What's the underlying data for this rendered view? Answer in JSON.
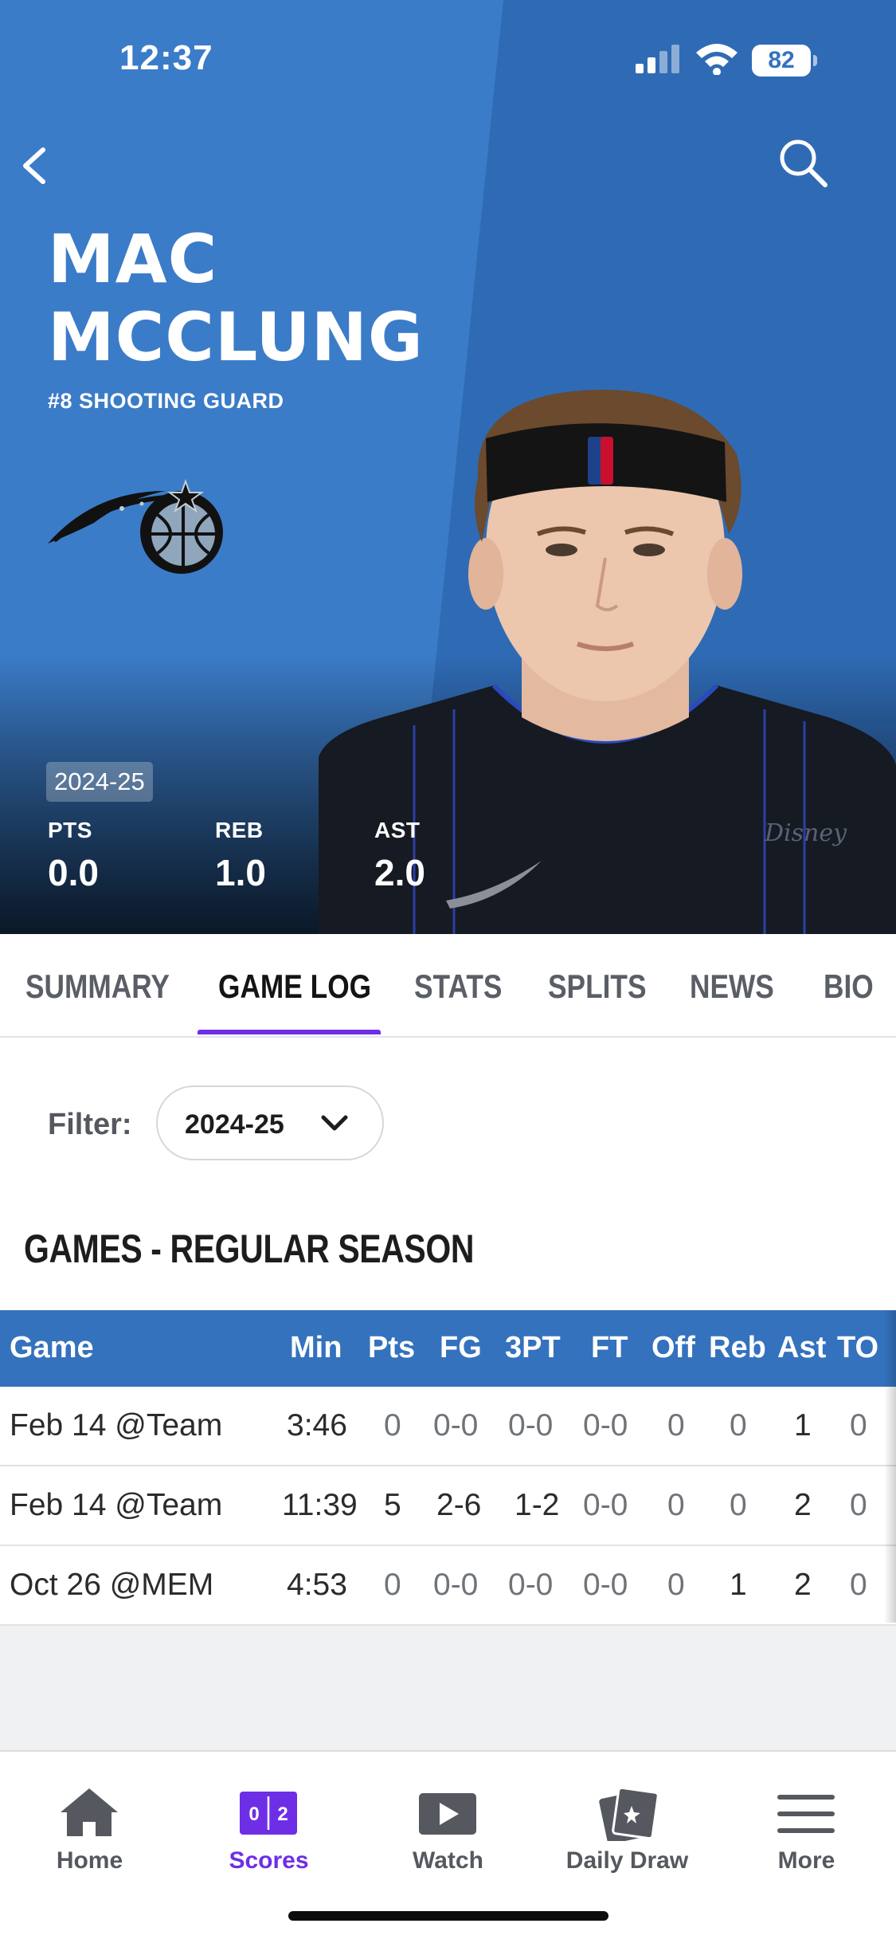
{
  "status": {
    "time": "12:37",
    "battery": "82"
  },
  "player": {
    "first_name": "MAC",
    "last_name": "MCCLUNG",
    "subtitle": "#8 SHOOTING GUARD",
    "season": "2024-25",
    "stats": [
      {
        "label": "PTS",
        "value": "0.0"
      },
      {
        "label": "REB",
        "value": "1.0"
      },
      {
        "label": "AST",
        "value": "2.0"
      }
    ]
  },
  "tabs": [
    "SUMMARY",
    "GAME LOG",
    "STATS",
    "SPLITS",
    "NEWS",
    "BIO"
  ],
  "active_tab": "GAME LOG",
  "filter": {
    "label": "Filter:",
    "value": "2024-25"
  },
  "section_title": "GAMES - REGULAR SEASON",
  "table": {
    "headers": [
      "Game",
      "Min",
      "Pts",
      "FG",
      "3PT",
      "FT",
      "Off",
      "Reb",
      "Ast",
      "TO"
    ],
    "rows": [
      [
        "Feb 14 @Team",
        "3:46",
        "0",
        "0-0",
        "0-0",
        "0-0",
        "0",
        "0",
        "1",
        "0"
      ],
      [
        "Feb 14 @Team",
        "11:39",
        "5",
        "2-6",
        "1-2",
        "0-0",
        "0",
        "0",
        "2",
        "0"
      ],
      [
        "Oct 26 @MEM",
        "4:53",
        "0",
        "0-0",
        "0-0",
        "0-0",
        "0",
        "1",
        "2",
        "0"
      ]
    ]
  },
  "nav": [
    {
      "label": "Home",
      "icon": "home-icon"
    },
    {
      "label": "Scores",
      "icon": "scores-icon",
      "active": true
    },
    {
      "label": "Watch",
      "icon": "play-icon"
    },
    {
      "label": "Daily Draw",
      "icon": "cards-icon"
    },
    {
      "label": "More",
      "icon": "menu-icon"
    }
  ],
  "colors": {
    "hero_blue": "#3473bf",
    "table_header": "#3472bd",
    "accent_purple": "#6e2ee6"
  }
}
